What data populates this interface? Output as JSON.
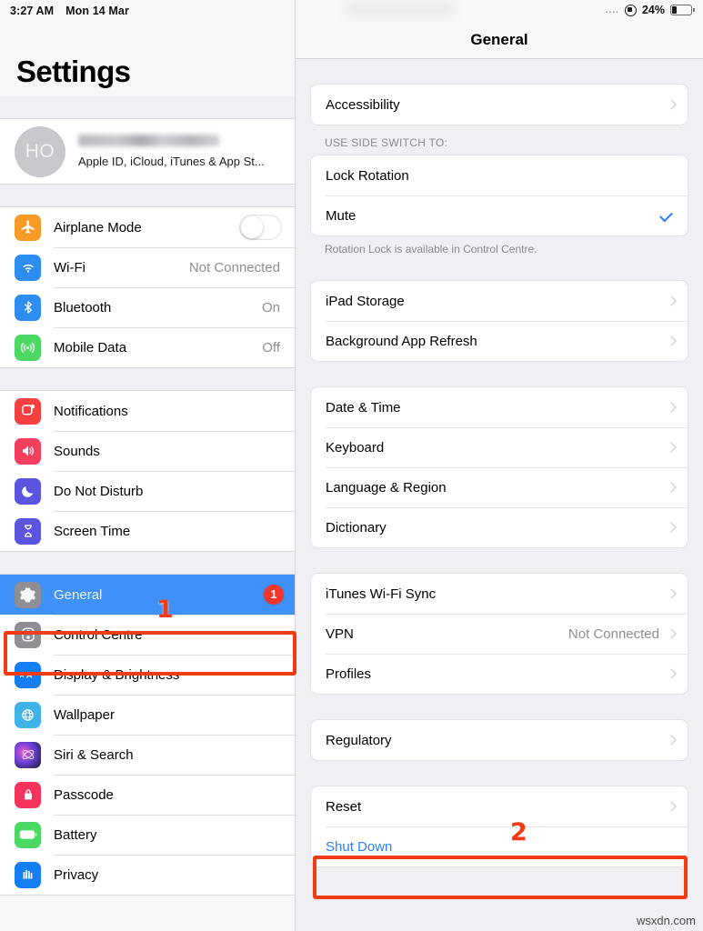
{
  "status_bar": {
    "time": "3:27 AM",
    "date": "Mon 14 Mar",
    "signal_dots": "....",
    "rotation_lock_icon": "rotation-lock-icon",
    "battery_percent": "24%",
    "battery_level": 24
  },
  "sidebar": {
    "title": "Settings",
    "account": {
      "avatar_initials": "HO",
      "name_redacted": true,
      "subtitle": "Apple ID, iCloud, iTunes & App St..."
    },
    "groups": [
      {
        "items": [
          {
            "label": "Airplane Mode",
            "icon": "airplane-icon",
            "control": "toggle",
            "toggle_on": false
          },
          {
            "label": "Wi-Fi",
            "icon": "wifi-icon",
            "value": "Not Connected"
          },
          {
            "label": "Bluetooth",
            "icon": "bluetooth-icon",
            "value": "On"
          },
          {
            "label": "Mobile Data",
            "icon": "cellular-icon",
            "value": "Off"
          }
        ]
      },
      {
        "items": [
          {
            "label": "Notifications",
            "icon": "notifications-icon"
          },
          {
            "label": "Sounds",
            "icon": "sounds-icon"
          },
          {
            "label": "Do Not Disturb",
            "icon": "moon-icon"
          },
          {
            "label": "Screen Time",
            "icon": "hourglass-icon"
          }
        ]
      },
      {
        "items": [
          {
            "label": "General",
            "icon": "gear-icon",
            "selected": true,
            "badge": "1"
          },
          {
            "label": "Control Centre",
            "icon": "control-centre-icon"
          },
          {
            "label": "Display & Brightness",
            "icon": "display-icon"
          },
          {
            "label": "Wallpaper",
            "icon": "wallpaper-icon"
          },
          {
            "label": "Siri & Search",
            "icon": "siri-icon"
          },
          {
            "label": "Passcode",
            "icon": "lock-icon"
          },
          {
            "label": "Battery",
            "icon": "battery-icon"
          },
          {
            "label": "Privacy",
            "icon": "privacy-hand-icon"
          }
        ]
      }
    ]
  },
  "detail": {
    "nav_title": "General",
    "sections": [
      {
        "header": "",
        "footer": "",
        "rows": [
          {
            "label": "Accessibility",
            "accessory": "chevron"
          }
        ]
      },
      {
        "header": "USE SIDE SWITCH TO:",
        "footer": "Rotation Lock is available in Control Centre.",
        "rows": [
          {
            "label": "Lock Rotation",
            "accessory": "none"
          },
          {
            "label": "Mute",
            "accessory": "check"
          }
        ]
      },
      {
        "header": "",
        "footer": "",
        "rows": [
          {
            "label": "iPad Storage",
            "accessory": "chevron"
          },
          {
            "label": "Background App Refresh",
            "accessory": "chevron"
          }
        ]
      },
      {
        "header": "",
        "footer": "",
        "rows": [
          {
            "label": "Date & Time",
            "accessory": "chevron"
          },
          {
            "label": "Keyboard",
            "accessory": "chevron"
          },
          {
            "label": "Language & Region",
            "accessory": "chevron"
          },
          {
            "label": "Dictionary",
            "accessory": "chevron"
          }
        ]
      },
      {
        "header": "",
        "footer": "",
        "rows": [
          {
            "label": "iTunes Wi-Fi Sync",
            "accessory": "chevron"
          },
          {
            "label": "VPN",
            "value": "Not Connected",
            "accessory": "chevron"
          },
          {
            "label": "Profiles",
            "accessory": "chevron"
          }
        ]
      },
      {
        "header": "",
        "footer": "",
        "rows": [
          {
            "label": "Regulatory",
            "accessory": "chevron"
          }
        ]
      },
      {
        "header": "",
        "footer": "",
        "rows": [
          {
            "label": "Reset",
            "accessory": "chevron"
          },
          {
            "label": "Shut Down",
            "accessory": "none",
            "style": "link"
          }
        ]
      }
    ]
  },
  "annotations": [
    {
      "number": "1",
      "target": "general-sidebar-row"
    },
    {
      "number": "2",
      "target": "shut-down-row"
    }
  ],
  "watermark": "wsxdn.com",
  "colors": {
    "accent_blue": "#2f7cf6",
    "selected_row": "#3f90f7",
    "annotation_red": "#f23a13",
    "badge_red": "#f5352a",
    "group_bg": "#efeff4",
    "row_bg": "#ffffff",
    "secondary_text": "#8e8e93"
  }
}
